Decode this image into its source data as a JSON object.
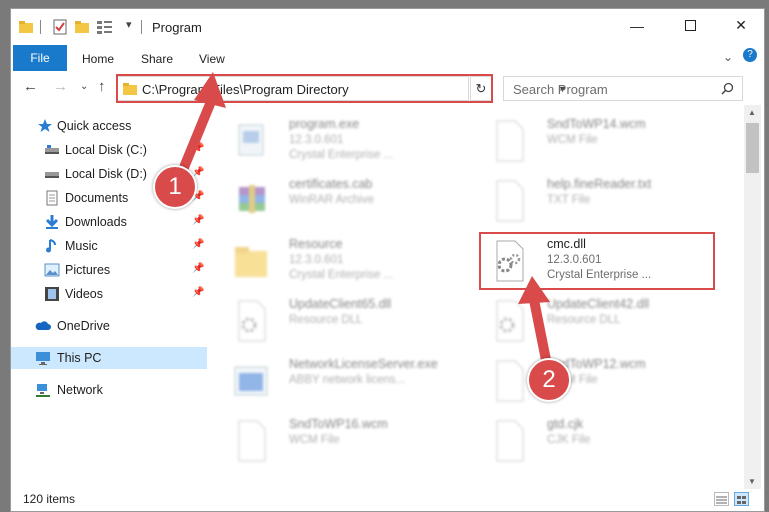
{
  "window": {
    "title": "Program"
  },
  "ribbon": {
    "file": "File",
    "tabs": [
      "Home",
      "Share",
      "View"
    ]
  },
  "navbar": {
    "address": "C:\\Program Files\\Program Directory",
    "search_placeholder": "Search Program"
  },
  "nav_pane": [
    {
      "label": "Quick access",
      "icon": "star-icon",
      "pinned": false
    },
    {
      "label": "Local Disk (C:)",
      "icon": "drive-icon",
      "pinned": true
    },
    {
      "label": "Local Disk (D:)",
      "icon": "drive-icon",
      "pinned": true
    },
    {
      "label": "Documents",
      "icon": "documents-icon",
      "pinned": true
    },
    {
      "label": "Downloads",
      "icon": "download-icon",
      "pinned": true
    },
    {
      "label": "Music",
      "icon": "music-icon",
      "pinned": true
    },
    {
      "label": "Pictures",
      "icon": "pictures-icon",
      "pinned": true
    },
    {
      "label": "Videos",
      "icon": "videos-icon",
      "pinned": true
    },
    {
      "label": "OneDrive",
      "icon": "cloud-icon",
      "pinned": false
    },
    {
      "label": "This PC",
      "icon": "computer-icon",
      "pinned": false,
      "selected": true
    },
    {
      "label": "Network",
      "icon": "network-icon",
      "pinned": false
    }
  ],
  "files": [
    {
      "name": "program.exe",
      "sub1": "12.3.0.601",
      "sub2": "Crystal Enterprise ...",
      "icon": "exe-icon"
    },
    {
      "name": "SndToWP14.wcm",
      "sub1": "WCM File",
      "sub2": "",
      "icon": "generic-file-icon"
    },
    {
      "name": "certificates.cab",
      "sub1": "WinRAR Archive",
      "sub2": "",
      "icon": "archive-icon"
    },
    {
      "name": "help.fineReader.txt",
      "sub1": "TXT File",
      "sub2": "",
      "icon": "generic-file-icon"
    },
    {
      "name": "Resource",
      "sub1": "12.3.0.601",
      "sub2": "Crystal Enterprise ...",
      "icon": "folder-icon"
    },
    {
      "name": "cmc.dll",
      "sub1": "12.3.0.601",
      "sub2": "Crystal Enterprise ...",
      "icon": "dll-gear-icon",
      "highlighted": true
    },
    {
      "name": "UpdateClient65.dll",
      "sub1": "Resource DLL",
      "sub2": "",
      "icon": "dll-gear-icon"
    },
    {
      "name": "UpdateClient42.dll",
      "sub1": "Resource DLL",
      "sub2": "",
      "icon": "dll-gear-icon"
    },
    {
      "name": "NetworkLicenseServer.exe",
      "sub1": "ABBY network licens...",
      "sub2": "",
      "icon": "app-window-icon"
    },
    {
      "name": "SndToWP12.wcm",
      "sub1": "WCM File",
      "sub2": "",
      "icon": "generic-file-icon"
    },
    {
      "name": "SndToWP16.wcm",
      "sub1": "WCM File",
      "sub2": "",
      "icon": "generic-file-icon"
    },
    {
      "name": "gtd.cjk",
      "sub1": "CJK File",
      "sub2": "",
      "icon": "generic-file-icon"
    }
  ],
  "status": {
    "count": "120 items"
  },
  "annotations": {
    "step1": "1",
    "step2": "2"
  },
  "colors": {
    "accent": "#1979ca",
    "highlight": "#d94a4a",
    "selected": "#cce8ff"
  }
}
